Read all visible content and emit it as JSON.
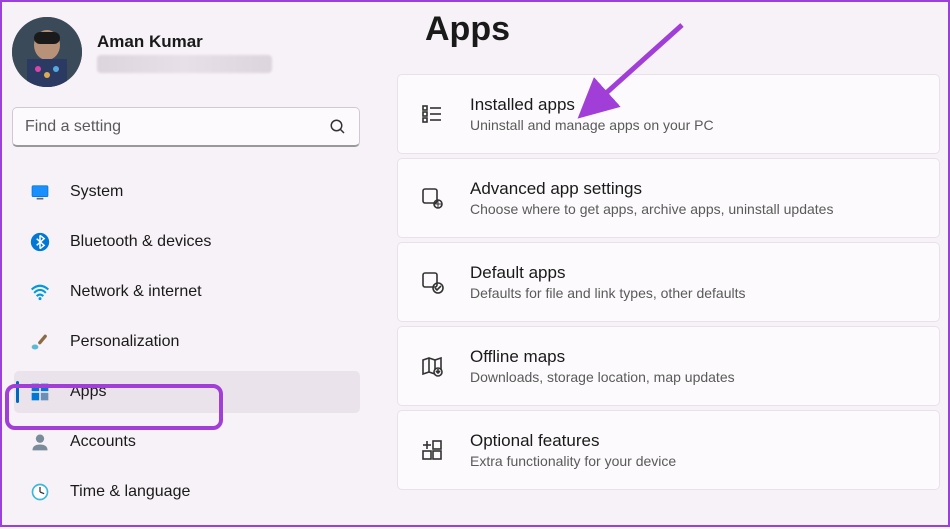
{
  "profile": {
    "name": "Aman Kumar"
  },
  "search": {
    "placeholder": "Find a setting"
  },
  "sidebar": {
    "items": [
      {
        "label": "System",
        "icon": "system-icon"
      },
      {
        "label": "Bluetooth & devices",
        "icon": "bluetooth-icon"
      },
      {
        "label": "Network & internet",
        "icon": "wifi-icon"
      },
      {
        "label": "Personalization",
        "icon": "paintbrush-icon"
      },
      {
        "label": "Apps",
        "icon": "apps-icon"
      },
      {
        "label": "Accounts",
        "icon": "accounts-icon"
      },
      {
        "label": "Time & language",
        "icon": "clock-icon"
      }
    ]
  },
  "main": {
    "title": "Apps",
    "cards": [
      {
        "title": "Installed apps",
        "sub": "Uninstall and manage apps on your PC",
        "icon": "list-icon"
      },
      {
        "title": "Advanced app settings",
        "sub": "Choose where to get apps, archive apps, uninstall updates",
        "icon": "app-gear-icon"
      },
      {
        "title": "Default apps",
        "sub": "Defaults for file and link types, other defaults",
        "icon": "default-apps-icon"
      },
      {
        "title": "Offline maps",
        "sub": "Downloads, storage location, map updates",
        "icon": "map-icon"
      },
      {
        "title": "Optional features",
        "sub": "Extra functionality for your device",
        "icon": "plus-grid-icon"
      }
    ]
  }
}
